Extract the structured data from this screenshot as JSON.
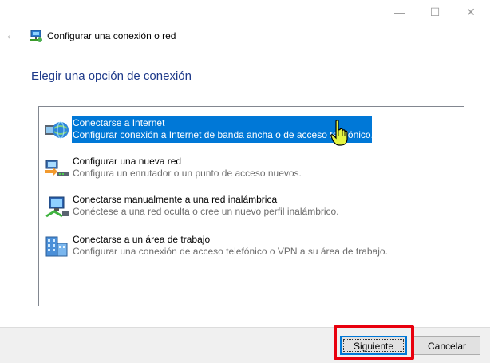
{
  "window": {
    "controls": {
      "minimize": "—",
      "maximize": "☐",
      "close": "✕"
    }
  },
  "header": {
    "back_icon": "back-arrow-icon",
    "title": "Configurar una conexión o red",
    "heading": "Elegir una opción de conexión"
  },
  "options": [
    {
      "title": "Conectarse a Internet",
      "description": "Configurar conexión a Internet de banda ancha o de acceso telefónico.",
      "icon": "globe-network-icon",
      "selected": true
    },
    {
      "title": "Configurar una nueva red",
      "description": "Configura un enrutador o un punto de acceso nuevos.",
      "icon": "new-network-icon",
      "selected": false
    },
    {
      "title": "Conectarse manualmente a una red inalámbrica",
      "description": "Conéctese a una red oculta o cree un nuevo perfil inalámbrico.",
      "icon": "wireless-network-icon",
      "selected": false
    },
    {
      "title": "Conectarse a un área de trabajo",
      "description": "Configurar una conexión de acceso telefónico o VPN a su área de trabajo.",
      "icon": "workplace-icon",
      "selected": false
    }
  ],
  "buttons": {
    "next": "Siguiente",
    "cancel": "Cancelar"
  },
  "colors": {
    "selection": "#0078d7",
    "heading": "#1e3a8a",
    "highlight": "#e8000d",
    "cursor": "#e5f542"
  }
}
